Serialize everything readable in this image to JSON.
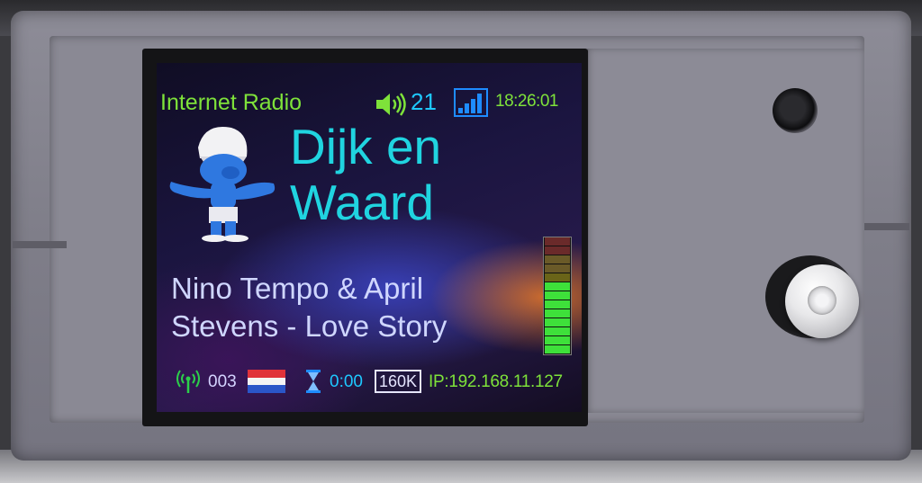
{
  "screen": {
    "title": "Internet Radio",
    "volume": "21",
    "clock": "18:26:01",
    "station_line1": "Dijk en",
    "station_line2": "Waard",
    "track_line1": "Nino Tempo & April",
    "track_line2": "Stevens - Love Story",
    "preset_number": "003",
    "elapsed": "0:00",
    "bitrate": "160K",
    "ip": "IP:192.168.11.127",
    "vu_level": 0.62,
    "signal_bars": 4
  },
  "icons": {
    "volume": "speaker-icon",
    "signal": "signal-strength-icon",
    "logo": "station-logo",
    "antenna": "antenna-icon",
    "flag": "netherlands-flag-icon",
    "hourglass": "hourglass-icon"
  },
  "colors": {
    "green_text": "#7ee23a",
    "cyan_text": "#20d4e0",
    "blue_text": "#1ec8ff",
    "track_text": "#cfd6ff",
    "enclosure": "#8d8c97"
  }
}
